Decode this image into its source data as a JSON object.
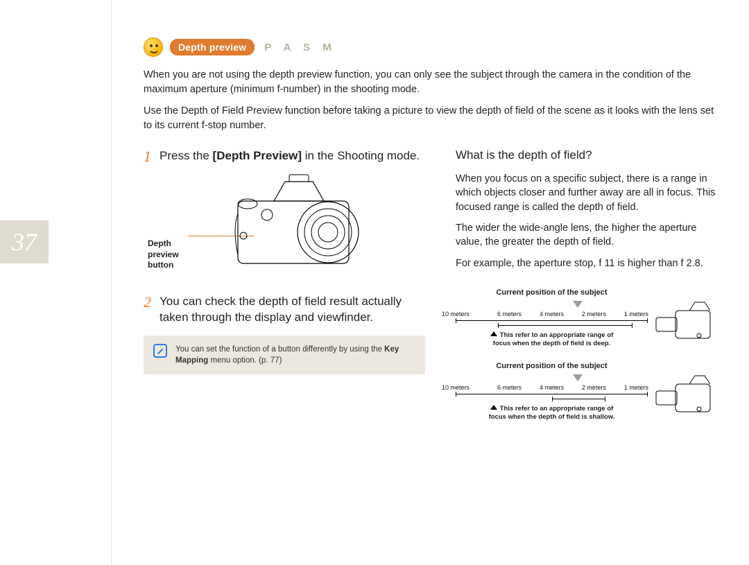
{
  "page_number": "37",
  "title_pill": "Depth preview",
  "mode_letters": "P A S M",
  "intro": {
    "p1": "When you are not using the depth preview function, you can only see the subject through the camera in the condition of the maximum aperture (minimum f-number) in the shooting mode.",
    "p2": "Use the Depth of Field Preview function before taking a picture to view the depth of field of the scene as it looks with the lens set to its current f-stop number."
  },
  "steps": [
    {
      "num": "1",
      "pre": "Press the ",
      "bold": "[Depth Preview]",
      "post": " in the Shooting mode."
    },
    {
      "num": "2",
      "text": "You can check the depth of field result actually taken through the display and viewfinder."
    }
  ],
  "camera_label": "Depth preview button",
  "note": {
    "pre": "You can set the function of a button differently by using the ",
    "bold": "Key Mapping",
    "post": " menu option. (p. 77)"
  },
  "right": {
    "heading": "What is the depth of field?",
    "p1": "When you focus on a specific subject, there is a range in which objects closer and further away are all in focus. This focused range is called the depth of field.",
    "p2": "The wider the wide-angle lens, the higher the aperture value, the greater the depth of field.",
    "p3": "For example, the aperture stop, f 11 is higher than f 2.8."
  },
  "dof": [
    {
      "title": "Current position of the subject",
      "ticks": [
        "10 meters",
        "6 meters",
        "4 meters",
        "2 meters",
        "1 meters"
      ],
      "caption1": "This refer to an appropriate range of",
      "caption2": "focus when the depth of field is deep.",
      "variant": "deep"
    },
    {
      "title": "Current position of the subject",
      "ticks": [
        "10 meters",
        "6 meters",
        "4 meters",
        "2 meters",
        "1 meters"
      ],
      "caption1": "This refer to an appropriate range of",
      "caption2": "focus when the depth of field is shallow.",
      "variant": "shallow"
    }
  ]
}
